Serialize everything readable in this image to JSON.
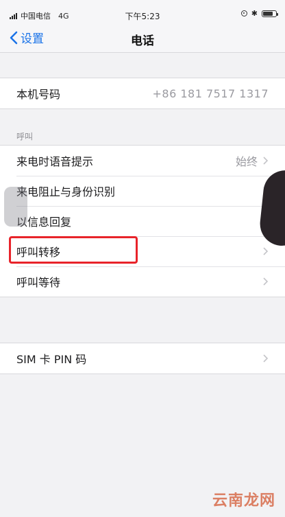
{
  "status_bar": {
    "carrier": "中国电信",
    "network": "4G",
    "time": "下午5:23",
    "bluetooth": "✱",
    "battery_level": 0.8
  },
  "nav": {
    "back_label": "设置",
    "title": "电话"
  },
  "my_number": {
    "label": "本机号码",
    "value": "+86 181 7517 1317"
  },
  "calls_section": {
    "header": "呼叫",
    "items": [
      {
        "label": "来电时语音提示",
        "value": "始终"
      },
      {
        "label": "来电阻止与身份识别",
        "value": ""
      },
      {
        "label": "以信息回复",
        "value": ""
      },
      {
        "label": "呼叫转移",
        "value": ""
      },
      {
        "label": "呼叫等待",
        "value": ""
      }
    ]
  },
  "sim": {
    "label": "SIM 卡 PIN 码"
  },
  "watermark": "云南龙网"
}
